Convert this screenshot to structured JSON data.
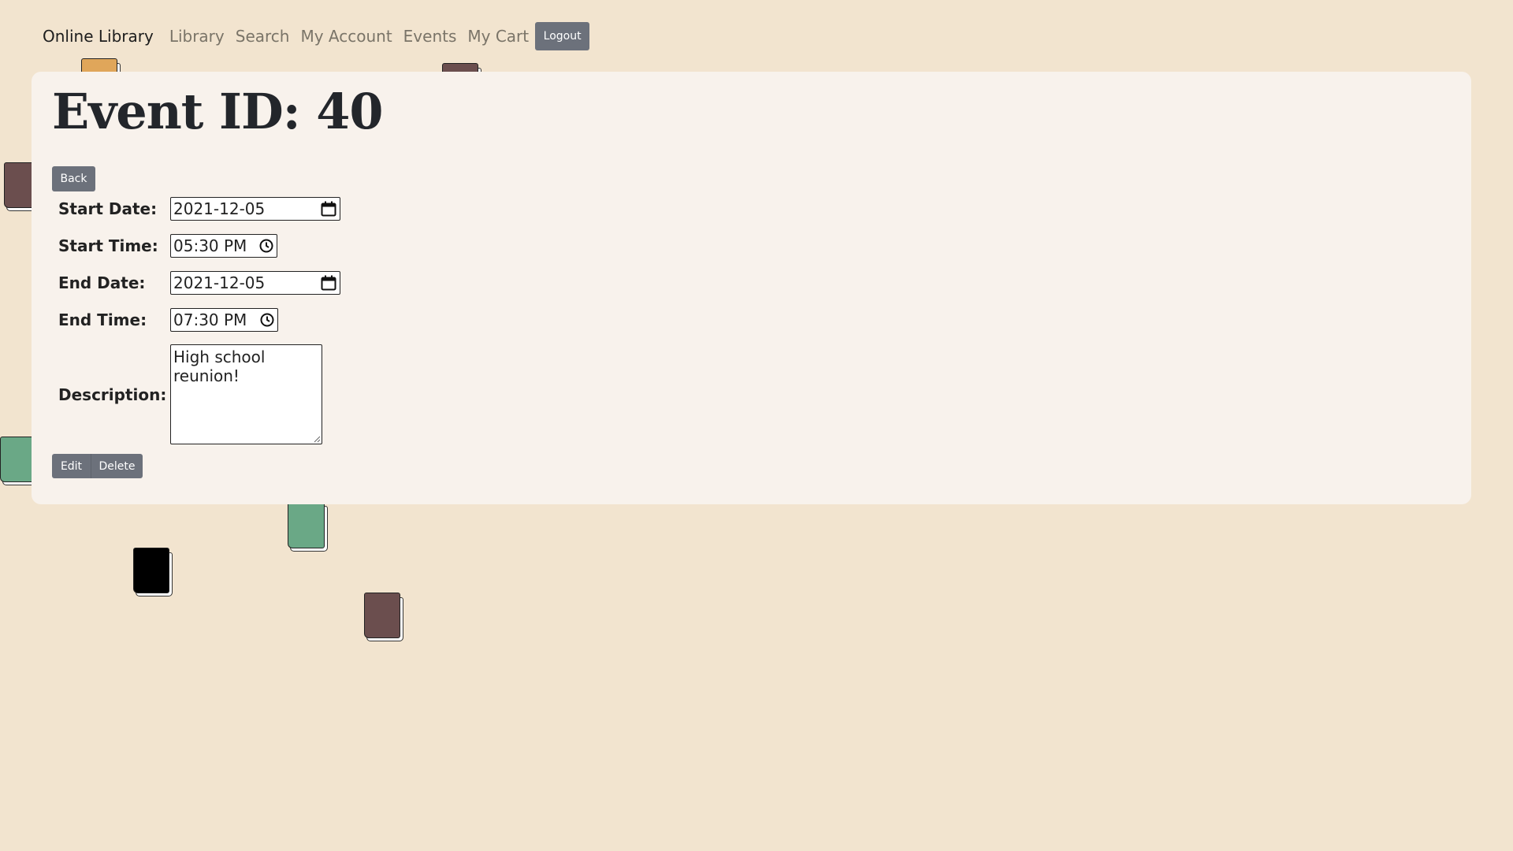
{
  "navbar": {
    "brand": "Online Library",
    "links": [
      "Library",
      "Search",
      "My Account",
      "Events",
      "My Cart"
    ],
    "logout_label": "Logout"
  },
  "page": {
    "title": "Event ID: 40",
    "back_label": "Back"
  },
  "form": {
    "start_date_label": "Start Date:",
    "start_date_value": "2021-12-05",
    "start_time_label": "Start Time:",
    "start_time_value": "05:30 PM",
    "end_date_label": "End Date:",
    "end_date_value": "2021-12-05",
    "end_time_label": "End Time:",
    "end_time_value": "07:30 PM",
    "description_label": "Description:",
    "description_value": "High school reunion!"
  },
  "actions": {
    "edit_label": "Edit",
    "delete_label": "Delete"
  },
  "colors": {
    "background": "#f2e4cf",
    "card": "#f8f2ec",
    "button": "#6c717b",
    "book_brown": "#6b4e4e",
    "book_green": "#6aa886",
    "book_orange": "#e0a65a",
    "book_black": "#000000"
  },
  "icons": [
    "calendar-icon",
    "clock-icon"
  ]
}
